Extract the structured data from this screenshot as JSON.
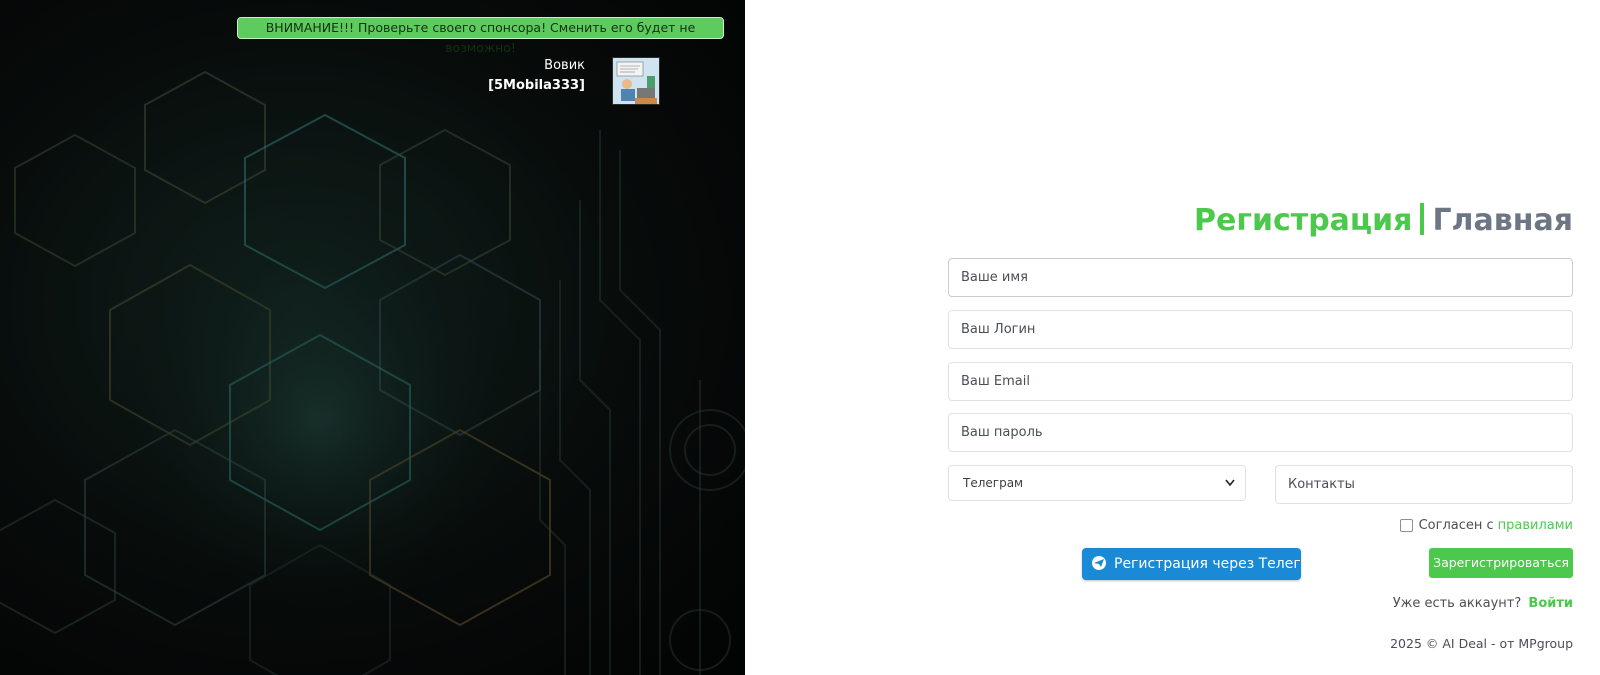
{
  "sponsor": {
    "warning": "ВНИМАНИЕ!!! Проверьте своего спонсора! Сменить его будет не возможно!",
    "name": "Вовик",
    "login": "[5Mobila333]",
    "avatar_icon": "sponsor-avatar-image"
  },
  "form": {
    "tab_register": "Регистрация",
    "tab_main": "Главная",
    "name_placeholder": "Ваше имя",
    "login_placeholder": "Ваш Логин",
    "email_placeholder": "Ваш Email",
    "password_placeholder": "Ваш пароль",
    "contact_type": "Телеграм",
    "contacts_placeholder": "Контакты",
    "agree_text": "Согласен с",
    "rules_link": "правилами",
    "telegram_button": "Регистрация через Телеграм",
    "register_button": "Зарегистрироваться",
    "have_account": "Уже есть аккаунт?",
    "login_link": "Войти"
  },
  "footer": "2025 © AI Deal - от MPgroup",
  "colors": {
    "accent_green": "#4cc94c",
    "telegram_blue": "#1a8ad6",
    "tab_inactive": "#6c7684"
  }
}
